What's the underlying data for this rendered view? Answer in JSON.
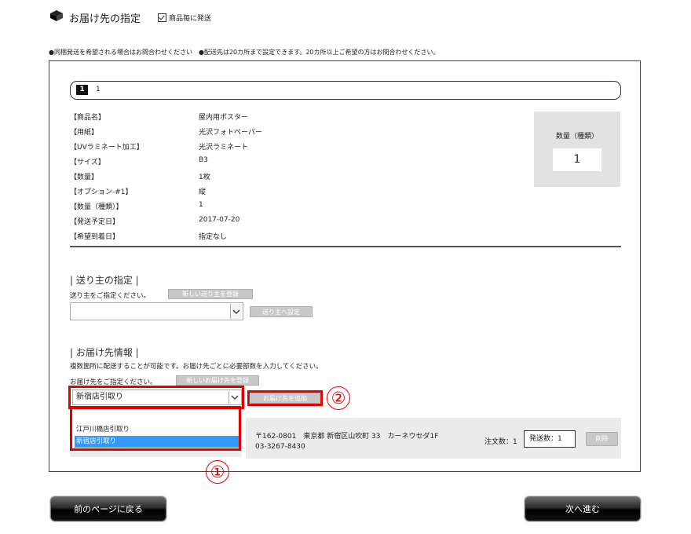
{
  "header": {
    "title": "お届け先の指定",
    "checkbox_label": "商品毎に発送",
    "checkbox_checked": true
  },
  "notice": "●同梱発送を希望される場合はお問合わせください　●配送先は20カ所まで設定できます。20カ所以上ご希望の方はお問合わせください。",
  "pager": {
    "active": "1",
    "other": "1"
  },
  "specs": [
    {
      "label": "【商品名】",
      "value": "屋内用ポスター"
    },
    {
      "label": "【用紙】",
      "value": "光沢フォトペーパー"
    },
    {
      "label": "【UVラミネート加工】",
      "value": "光沢ラミネート"
    },
    {
      "label": "【サイズ】",
      "value": "B3"
    },
    {
      "label": "【数量】",
      "value": "1枚"
    },
    {
      "label": "【オプション-#1】",
      "value": "縦"
    },
    {
      "label": "【数量（種類）】",
      "value": "1"
    },
    {
      "label": "【発送予定日】",
      "value": "2017-07-20"
    },
    {
      "label": "【希望到着日】",
      "value": "指定なし"
    }
  ],
  "quantity_box": {
    "label": "数量（種類）",
    "value": "1"
  },
  "sender": {
    "title": "| 送り主の指定 |",
    "desc": "送り主をご指定ください。",
    "register_button": "新しい送り主を登録",
    "select_value": "",
    "set_button": "送り主へ設定"
  },
  "delivery": {
    "title": "| お届け先情報 |",
    "desc1": "複数箇所に配送することが可能です。お届け先ごとに必要部数を入力してください。",
    "desc2": "お届け先をご指定ください。",
    "register_button": "新しいお届け先を登録",
    "select_value": "新宿店引取り",
    "add_button": "お届け先を追加",
    "options": [
      "",
      "江戸川橋店引取り",
      "新宿店引取り"
    ],
    "selected_option": "新宿店引取り"
  },
  "address_card": {
    "address": "〒162-0801　東京都 新宿区山吹町 33　カーネウセダ1F",
    "phone": "03-3267-8430",
    "order_count": "注文数：1",
    "ship_count": "発送数：1",
    "delete_button": "削除"
  },
  "annotations": {
    "one": "①",
    "two": "②"
  },
  "nav": {
    "back": "前のページに戻る",
    "next": "次へ進む"
  },
  "colors": {
    "highlight_red": "#e00000",
    "selected_blue": "#3399ff",
    "disabled_button": "#c8c8c8"
  }
}
